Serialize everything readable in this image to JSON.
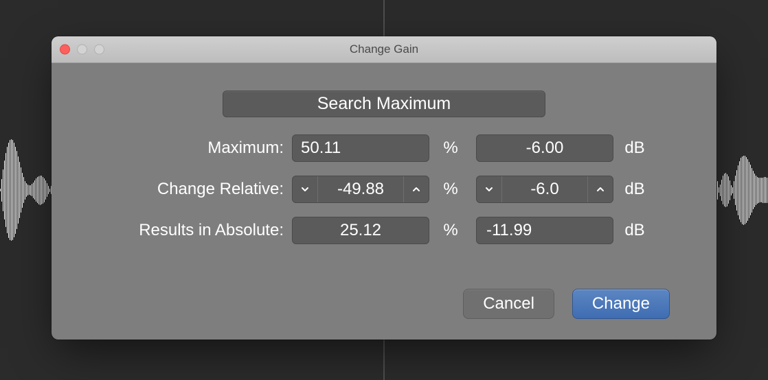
{
  "window": {
    "title": "Change Gain"
  },
  "buttons": {
    "search_maximum": "Search Maximum",
    "cancel": "Cancel",
    "change": "Change"
  },
  "labels": {
    "maximum": "Maximum:",
    "change_relative": "Change Relative:",
    "results_absolute": "Results in Absolute:",
    "percent": "%",
    "db": "dB"
  },
  "values": {
    "maximum_percent": "50.11",
    "maximum_db": "-6.00",
    "change_relative_percent": "-49.88",
    "change_relative_db": "-6.0",
    "results_absolute_percent": "25.12",
    "results_absolute_db": "-11.99"
  }
}
